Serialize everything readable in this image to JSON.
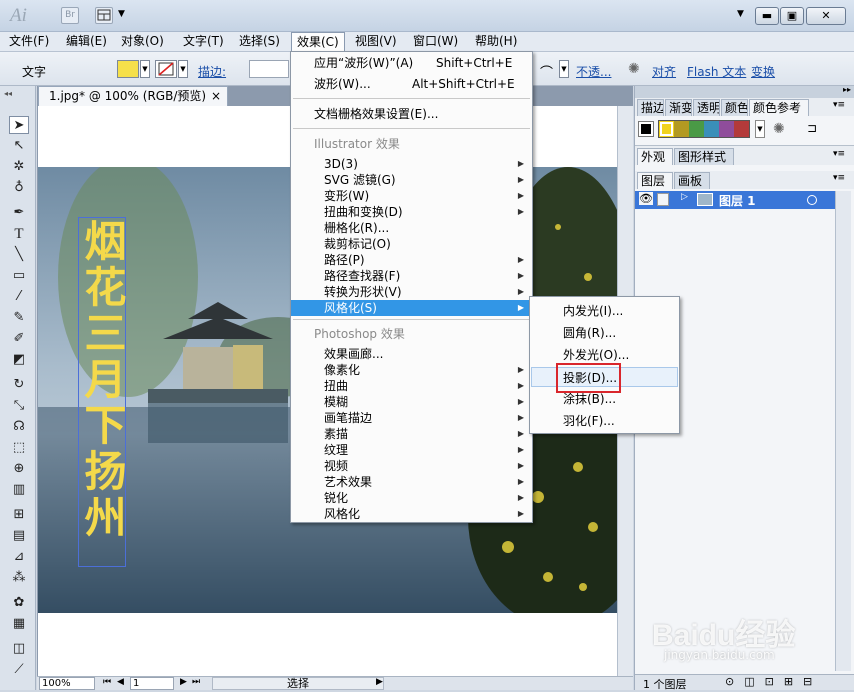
{
  "app": {
    "logo": "Ai",
    "bridge": "Br"
  },
  "menubar": [
    "文件(F)",
    "编辑(E)",
    "对象(O)",
    "文字(T)",
    "选择(S)",
    "效果(C)",
    "视图(V)",
    "窗口(W)",
    "帮助(H)"
  ],
  "control_bar": {
    "mode_label": "文字",
    "stroke_label": "描边:",
    "opacity_label": "不透...",
    "align_label": "对齐",
    "flash_label": "Flash 文本",
    "transform_label": "变换",
    "fill_color": "#f6e04a"
  },
  "document": {
    "tab_title": "1.jpg* @ 100% (RGB/预览)",
    "vertical_text": "烟花三月下扬州",
    "text_color": "#f4d94a"
  },
  "status": {
    "zoom": "100%",
    "page": "1",
    "tool": "选择"
  },
  "panels": {
    "top_tabs": [
      "描边",
      "渐变",
      "透明",
      "颜色",
      "颜色参考"
    ],
    "mid_tabs": [
      "外观",
      "图形样式"
    ],
    "layer_tabs": [
      "图层",
      "画板"
    ],
    "layer_name": "图层 1",
    "layer_count": "1 个图层",
    "swatches": [
      "#f1d31d",
      "#b39a22",
      "#4a9a46",
      "#3a8fb9",
      "#8f4d9b",
      "#b33a3a"
    ]
  },
  "effect_menu": {
    "items": [
      {
        "label": "应用“波形(W)”(A)",
        "shortcut": "Shift+Ctrl+E"
      },
      {
        "label": "波形(W)...",
        "shortcut": "Alt+Shift+Ctrl+E"
      },
      {
        "label": "文档栅格效果设置(E)...",
        "shortcut": ""
      }
    ],
    "illustrator_header": "Illustrator 效果",
    "illustrator_items": [
      "3D(3)",
      "SVG 滤镜(G)",
      "变形(W)",
      "扭曲和变换(D)",
      "栅格化(R)...",
      "裁剪标记(O)",
      "路径(P)",
      "路径查找器(F)",
      "转换为形状(V)",
      "风格化(S)"
    ],
    "photoshop_header": "Photoshop 效果",
    "photoshop_items": [
      "效果画廊...",
      "像素化",
      "扭曲",
      "模糊",
      "画笔描边",
      "素描",
      "纹理",
      "视频",
      "艺术效果",
      "锐化",
      "风格化"
    ]
  },
  "stylize_submenu": [
    "内发光(I)...",
    "圆角(R)...",
    "外发光(O)...",
    "投影(D)...",
    "涂抹(B)...",
    "羽化(F)..."
  ],
  "watermark": {
    "brand": "Baidu经验",
    "url": "jingyan.baidu.com"
  }
}
